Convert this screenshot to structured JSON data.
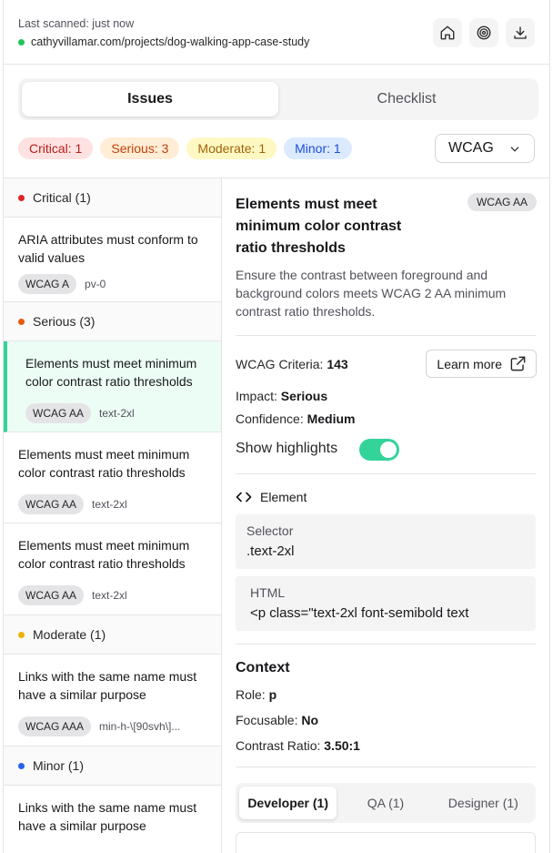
{
  "header": {
    "last_scanned": "Last scanned: just now",
    "url": "cathyvillamar.com/projects/dog-walking-app-case-study",
    "status_color": "#22c55e"
  },
  "tabs": [
    {
      "label": "Issues",
      "active": true
    },
    {
      "label": "Checklist",
      "active": false
    }
  ],
  "filters": [
    {
      "label": "Critical: 1"
    },
    {
      "label": "Serious: 3"
    },
    {
      "label": "Moderate: 1"
    },
    {
      "label": "Minor: 1"
    }
  ],
  "standard_select": {
    "value": "WCAG"
  },
  "issue_list": {
    "groups": [
      {
        "label": "Critical (1)",
        "color": "#dc2626"
      },
      {
        "label": "Serious (3)",
        "color": "#ea580c"
      },
      {
        "label": "Moderate (1)",
        "color": "#eab308"
      },
      {
        "label": "Minor (1)",
        "color": "#2563eb"
      }
    ],
    "items": [
      {
        "title": "ARIA attributes must conform to valid values",
        "tag": "WCAG A",
        "selector": "pv-0"
      },
      {
        "title": "Elements must meet minimum color contrast ratio thresholds",
        "tag": "WCAG AA",
        "selector": "text-2xl"
      },
      {
        "title": "Elements must meet minimum color contrast ratio thresholds",
        "tag": "WCAG AA",
        "selector": "text-2xl"
      },
      {
        "title": "Elements must meet minimum color contrast ratio thresholds",
        "tag": "WCAG AA",
        "selector": "text-2xl"
      },
      {
        "title": "Links with the same name must have a similar purpose",
        "tag": "WCAG AAA",
        "selector": "min-h-\\[90svh\\]..."
      },
      {
        "title": "Links with the same name must have a similar purpose"
      }
    ]
  },
  "detail": {
    "title": "Elements must meet minimum color contrast ratio thresholds",
    "badge": "WCAG AA",
    "description": "Ensure the contrast between foreground and background colors meets WCAG 2 AA minimum contrast ratio thresholds.",
    "criteria_label": "WCAG Criteria:",
    "criteria_value": "143",
    "learn_more": "Learn more",
    "impact_label": "Impact:",
    "impact_value": "Serious",
    "confidence_label": "Confidence:",
    "confidence_value": "Medium",
    "highlights_label": "Show highlights",
    "highlights_on": true,
    "element_heading": "Element",
    "selector_label": "Selector",
    "selector_value": ".text-2xl",
    "html_label": "HTML",
    "html_value": "<p class=\"text-2xl font-semibold text",
    "context_heading": "Context",
    "role_label": "Role:",
    "role_value": "p",
    "focusable_label": "Focusable:",
    "focusable_value": "No",
    "contrast_label": "Contrast Ratio:",
    "contrast_value": "3.50:1",
    "role_tabs": [
      {
        "label": "Developer (1)",
        "active": true
      },
      {
        "label": "QA (1)",
        "active": false
      },
      {
        "label": "Designer (1)",
        "active": false
      }
    ]
  },
  "colors": {
    "accent": "#34d399",
    "active_item_bg": "#ecfdf5"
  }
}
